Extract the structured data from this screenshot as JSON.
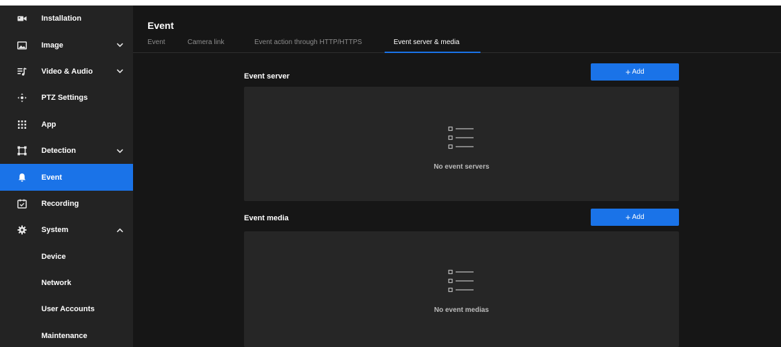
{
  "sidebar": {
    "items": [
      {
        "label": "Installation",
        "icon": "camera-icon",
        "chevron": null,
        "active": false
      },
      {
        "label": "Image",
        "icon": "image-icon",
        "chevron": "down",
        "active": false
      },
      {
        "label": "Video & Audio",
        "icon": "video-audio-icon",
        "chevron": "down",
        "active": false
      },
      {
        "label": "PTZ Settings",
        "icon": "ptz-icon",
        "chevron": null,
        "active": false
      },
      {
        "label": "App",
        "icon": "app-grid-icon",
        "chevron": null,
        "active": false
      },
      {
        "label": "Detection",
        "icon": "detection-icon",
        "chevron": "down",
        "active": false
      },
      {
        "label": "Event",
        "icon": "bell-icon",
        "chevron": null,
        "active": true
      },
      {
        "label": "Recording",
        "icon": "recording-icon",
        "chevron": null,
        "active": false
      },
      {
        "label": "System",
        "icon": "gear-icon",
        "chevron": "up",
        "active": false
      }
    ],
    "system_subitems": [
      {
        "label": "Device"
      },
      {
        "label": "Network"
      },
      {
        "label": "User Accounts"
      },
      {
        "label": "Maintenance"
      }
    ]
  },
  "main": {
    "title": "Event",
    "tabs": [
      {
        "label": "Event",
        "active": false
      },
      {
        "label": "Camera link",
        "active": false
      },
      {
        "label": "Event action through HTTP/HTTPS",
        "active": false
      },
      {
        "label": "Event server & media",
        "active": true
      }
    ],
    "event_server": {
      "title": "Event server",
      "add_label": "Add",
      "empty_text": "No event servers"
    },
    "event_media": {
      "title": "Event media",
      "add_label": "Add",
      "empty_text": "No event medias"
    }
  },
  "colors": {
    "accent": "#1a73e8",
    "background": "#161616",
    "sidebar": "#232323",
    "panel": "#262626"
  }
}
